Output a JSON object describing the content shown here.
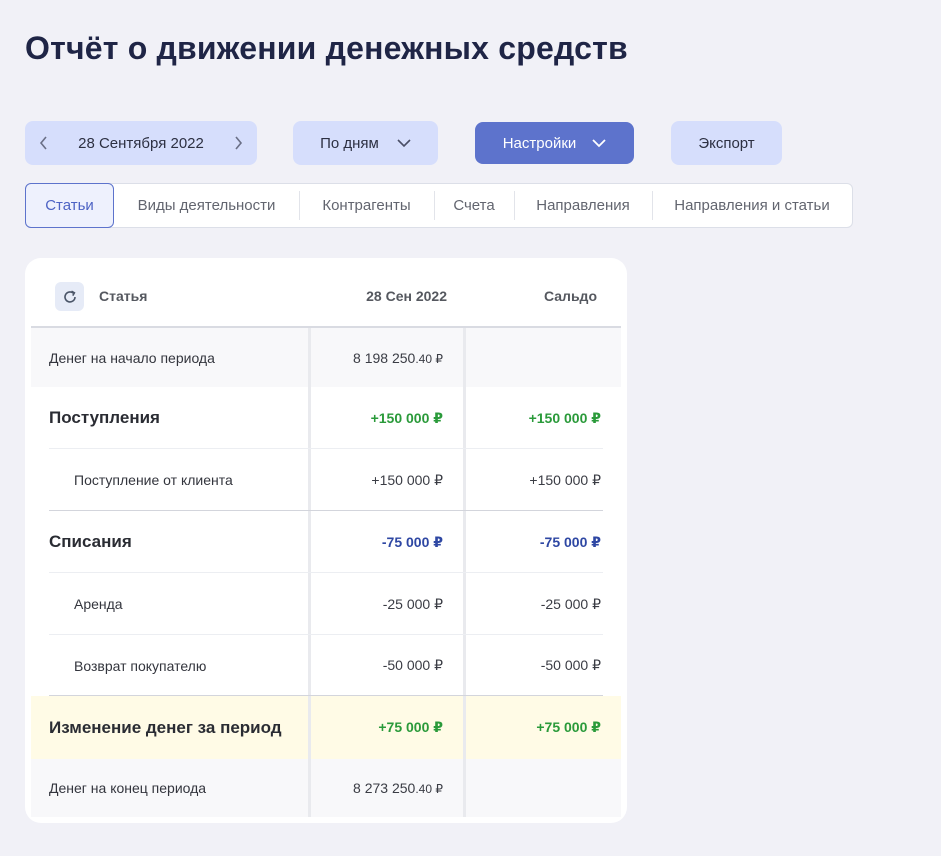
{
  "page": {
    "title": "Отчёт о движении денежных средств"
  },
  "toolbar": {
    "date": "28 Сентября 2022",
    "period_label": "По дням",
    "settings_label": "Настройки",
    "export_label": "Экспорт"
  },
  "tabs": [
    {
      "label": "Статьи",
      "active": true
    },
    {
      "label": "Виды деятельности",
      "active": false
    },
    {
      "label": "Контрагенты",
      "active": false
    },
    {
      "label": "Счета",
      "active": false
    },
    {
      "label": "Направления",
      "active": false
    },
    {
      "label": "Направления и статьи",
      "active": false
    }
  ],
  "table": {
    "headers": {
      "article": "Статья",
      "date": "28 Сен 2022",
      "balance": "Сальдо"
    },
    "rows": {
      "opening": {
        "label": "Денег на начало периода",
        "value_main": "8 198 250",
        "value_frac": ".40 ₽",
        "balance": ""
      },
      "income": {
        "label": "Поступления",
        "value": "+150 000 ₽",
        "balance": "+150 000 ₽"
      },
      "income_client": {
        "label": "Поступление от клиента",
        "value": "+150 000 ₽",
        "balance": "+150 000 ₽"
      },
      "expenses": {
        "label": "Списания",
        "value": "-75 000 ₽",
        "balance": "-75 000 ₽"
      },
      "rent": {
        "label": "Аренда",
        "value": "-25 000 ₽",
        "balance": "-25 000 ₽"
      },
      "refund": {
        "label": "Возврат покупателю",
        "value": "-50 000 ₽",
        "balance": "-50 000 ₽"
      },
      "change": {
        "label": "Изменение денег за период",
        "value": "+75 000 ₽",
        "balance": "+75 000 ₽"
      },
      "closing": {
        "label": "Денег на конец периода",
        "value_main": "8 273 250",
        "value_frac": ".40 ₽",
        "balance": ""
      }
    }
  },
  "colors": {
    "accent": "#5d73cc",
    "positive": "#2a9a3a",
    "negative": "#2e47a3",
    "highlight_row": "#fffbe6"
  },
  "icons": {
    "prev": "chevron-left-icon",
    "next": "chevron-right-icon",
    "dropdown": "chevron-down-icon",
    "refresh": "refresh-icon"
  }
}
